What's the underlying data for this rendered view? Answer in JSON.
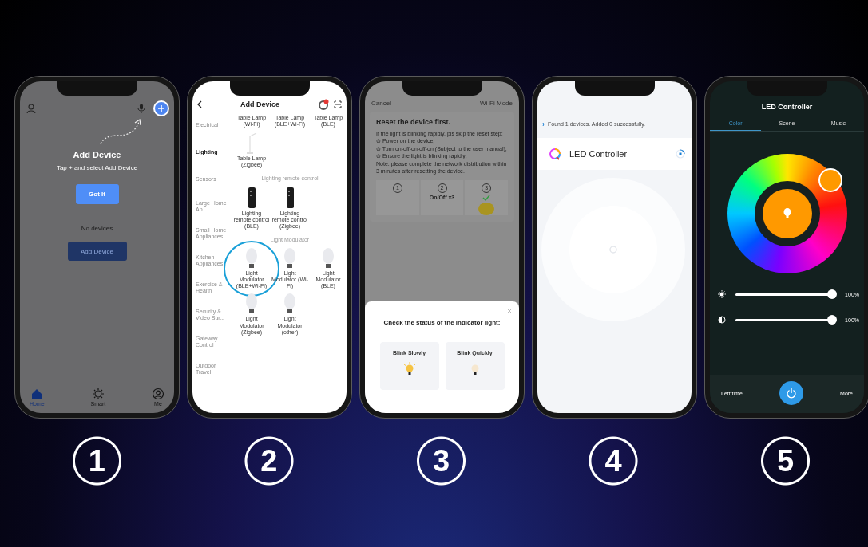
{
  "phones": [
    {
      "kind": "home",
      "title": "Add Device",
      "hint": "Tap + and select Add Device",
      "confirm": "Got It",
      "empty": "No devices",
      "add_button": "Add Device",
      "tabs": [
        {
          "label": "Home",
          "selected": true
        },
        {
          "label": "Smart",
          "selected": false
        },
        {
          "label": "Me",
          "selected": false
        }
      ]
    },
    {
      "kind": "catalog",
      "title": "Add Device",
      "categories": [
        {
          "label": "Electrical",
          "selected": false
        },
        {
          "label": "Lighting",
          "selected": true
        },
        {
          "label": "Sensors",
          "selected": false
        },
        {
          "label": "Large Home Ap...",
          "selected": false
        },
        {
          "label": "Small Home Appliances",
          "selected": false
        },
        {
          "label": "Kitchen Appliances",
          "selected": false
        },
        {
          "label": "Exercise & Health",
          "selected": false
        },
        {
          "label": "Security & Video Sur...",
          "selected": false
        },
        {
          "label": "Gateway Control",
          "selected": false
        },
        {
          "label": "Outdoor Travel",
          "selected": false
        }
      ],
      "content": [
        {
          "kind": "row",
          "items": [
            {
              "name": "Table Lamp (Wi-Fi)",
              "kind": "text",
              "highlighted": false
            },
            {
              "name": "Table Lamp (BLE+Wi-Fi)",
              "kind": "text",
              "highlighted": false
            },
            {
              "name": "Table Lamp (BLE)",
              "kind": "text",
              "highlighted": false
            }
          ]
        },
        {
          "kind": "row",
          "items": [
            {
              "name": "Table Lamp (Zigbee)",
              "kind": "lamp",
              "highlighted": false
            }
          ]
        },
        {
          "kind": "header",
          "label": "Lighting remote control"
        },
        {
          "kind": "row",
          "items": [
            {
              "name": "Lighting remote control (BLE)",
              "kind": "remote",
              "highlighted": false
            },
            {
              "name": "Lighting remote control (Zigbee)",
              "kind": "remote",
              "highlighted": false
            }
          ]
        },
        {
          "kind": "header",
          "label": "Light Modulator"
        },
        {
          "kind": "row",
          "items": [
            {
              "name": "Light Modulator (BLE+Wi-Fi)",
              "kind": "bulb",
              "highlighted": true
            },
            {
              "name": "Light Modulator (Wi-Fi)",
              "kind": "bulb",
              "highlighted": false
            },
            {
              "name": "Light Modulator (BLE)",
              "kind": "bulb",
              "highlighted": false
            }
          ]
        },
        {
          "kind": "row",
          "items": [
            {
              "name": "Light Modulator (Zigbee)",
              "kind": "bulb",
              "highlighted": false
            },
            {
              "name": "Light Modulator (other)",
              "kind": "bulb",
              "highlighted": false
            }
          ]
        }
      ]
    },
    {
      "kind": "reset",
      "cancel": "Cancel",
      "mode": "Wi-Fi Mode",
      "heading": "Reset the device first.",
      "lines": [
        "If the light is blinking rapidly, pls skip the reset step:",
        "⊙ Power on the device;",
        "⊙ Turn on-off-on-off-on (Subject to the user manual);",
        "⊙ Ensure the light is blinking rapidly;",
        "Note: please complete the network distribution within 3 minutes after resetting the device."
      ],
      "steps": [
        {
          "number": "1",
          "done": false
        },
        {
          "number": "2",
          "caption": "On/Off x3",
          "done": false
        },
        {
          "number": "3",
          "done": true
        }
      ],
      "sheet": {
        "title": "Check the status of the indicator light:",
        "options": [
          {
            "label": "Blink Slowly",
            "lit": true
          },
          {
            "label": "Blink Quickly",
            "lit": false
          }
        ]
      }
    },
    {
      "kind": "search",
      "status": "Found 1 devices. Added 0 successfully.",
      "device": "LED Controller"
    },
    {
      "kind": "controller",
      "title": "LED Controller",
      "tabs": [
        {
          "label": "Color",
          "selected": true
        },
        {
          "label": "Scene",
          "selected": false
        },
        {
          "label": "Music",
          "selected": false
        }
      ],
      "sliders": [
        {
          "kind": "brightness",
          "level": 1,
          "reading": "100%"
        },
        {
          "kind": "contrast",
          "level": 1,
          "reading": "100%"
        }
      ],
      "left": "Left time",
      "right": "More"
    }
  ],
  "steps": [
    "1",
    "2",
    "3",
    "4",
    "5"
  ]
}
